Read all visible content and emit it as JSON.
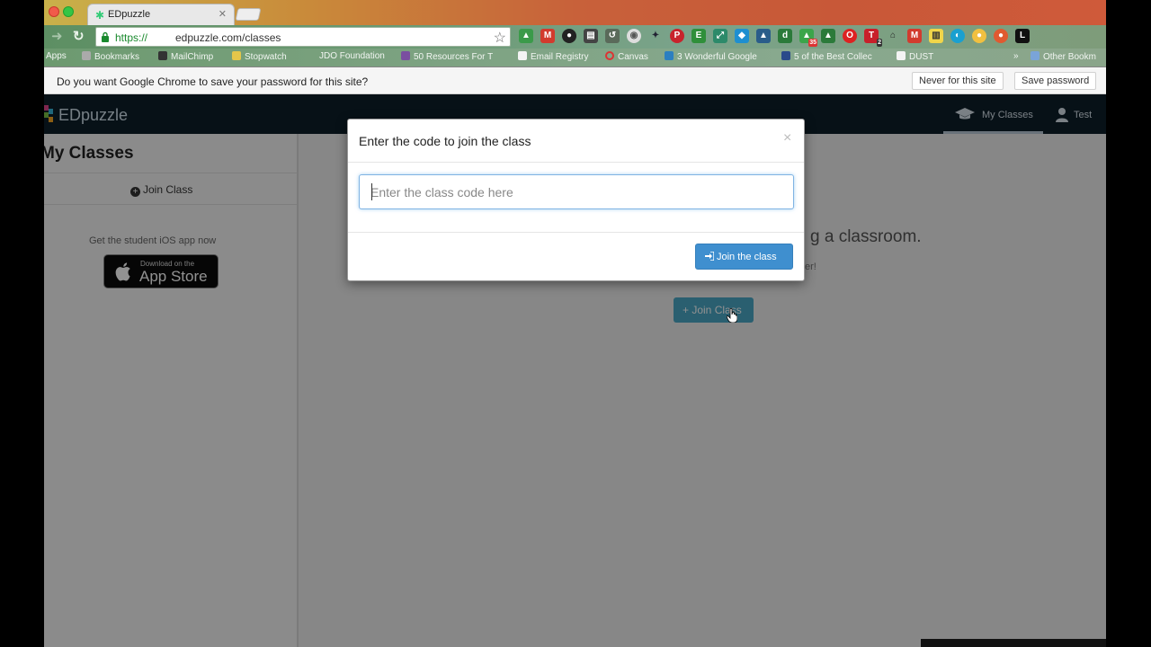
{
  "browser": {
    "tab": {
      "title": "EDpuzzle"
    },
    "url": {
      "scheme": "https://",
      "rest": "edpuzzle.com/classes"
    },
    "bookmarks": [
      "Apps",
      "Bookmarks",
      "MailChimp",
      "Stopwatch",
      "JDO Foundation",
      "50 Resources For T",
      "Email Registry",
      "Canvas",
      "3 Wonderful Google",
      "5 of the Best Collec",
      "DUST",
      "Other Bookm"
    ],
    "extension_badges": {
      "gmail_count": "35",
      "td_count": "2"
    },
    "infobar": {
      "message": "Do you want Google Chrome to save your password for this site?",
      "never_label": "Never for this site",
      "save_label": "Save password"
    }
  },
  "app": {
    "logo": "EDpuzzle",
    "nav": {
      "my_classes": "My Classes",
      "user": "Test"
    },
    "sidebar": {
      "title": "My Classes",
      "join_label": "Join Class",
      "ios_text": "Get the student iOS app now",
      "appstore_small": "Download on the",
      "appstore_big": "App Store"
    },
    "background": {
      "heading_partial": "g a classroom.",
      "sub_partial": "er!",
      "join_button": "Join Class"
    }
  },
  "modal": {
    "title": "Enter the code to join the class",
    "close": "×",
    "input_placeholder": "Enter the class code here",
    "submit_label": "Join the class"
  },
  "colors": {
    "primary_button": "#3f8fcf",
    "header_bg": "#0e1e2a",
    "https_green": "#1a8a2e"
  }
}
